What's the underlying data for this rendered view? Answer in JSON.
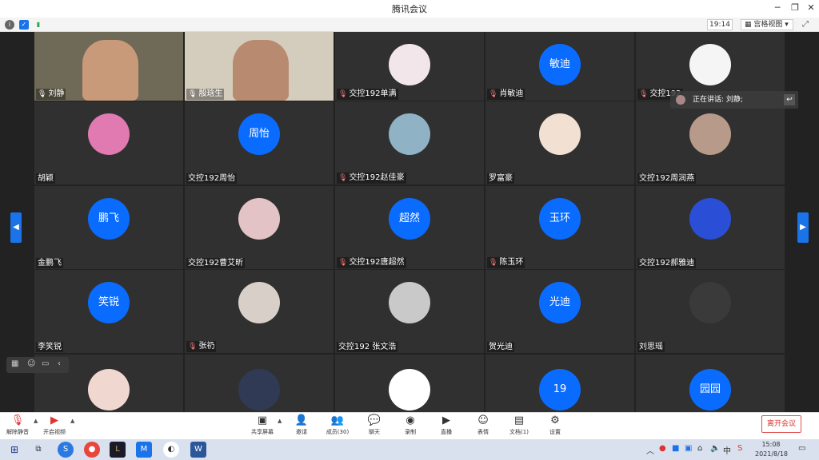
{
  "window": {
    "title": "腾讯会议"
  },
  "infobar": {
    "clock": "19:14",
    "view_mode": "宫格视图"
  },
  "speaking": {
    "label": "正在讲话: 刘静;"
  },
  "tiles": [
    {
      "name": "刘静",
      "type": "video",
      "mic": "on",
      "tone": "video1"
    },
    {
      "name": "殷琀生",
      "type": "video",
      "mic": "on",
      "tone": "video2"
    },
    {
      "name": "交控192单满",
      "type": "image",
      "mic": "muted",
      "avatar_color": "#f2e6ea"
    },
    {
      "name": "肖敏迪",
      "type": "text",
      "mic": "muted",
      "avatar_text": "敏迪"
    },
    {
      "name": "交控192",
      "type": "image",
      "mic": "muted",
      "avatar_color": "#f5f5f5"
    },
    {
      "name": "胡颖",
      "type": "image",
      "mic": "none",
      "avatar_color": "#e07ab0"
    },
    {
      "name": "交控192周怡",
      "type": "text",
      "mic": "none",
      "avatar_text": "周怡"
    },
    {
      "name": "交控192赵佳豪",
      "type": "image",
      "mic": "muted",
      "avatar_color": "#8fb3c4"
    },
    {
      "name": "罗富豪",
      "type": "image",
      "mic": "none",
      "avatar_color": "#f2e1d2"
    },
    {
      "name": "交控192周润燕",
      "type": "image",
      "mic": "none",
      "avatar_color": "#b79a8a"
    },
    {
      "name": "金鹏飞",
      "type": "text",
      "mic": "none",
      "avatar_text": "鹏飞"
    },
    {
      "name": "交控192曹艾昕",
      "type": "image",
      "mic": "none",
      "avatar_color": "#e3c3c6"
    },
    {
      "name": "交控192唐超然",
      "type": "text",
      "mic": "muted",
      "avatar_text": "超然"
    },
    {
      "name": "陈玉环",
      "type": "text",
      "mic": "muted",
      "avatar_text": "玉环"
    },
    {
      "name": "交控192郝雅迪",
      "type": "image",
      "mic": "none",
      "avatar_color": "#2a4fd6"
    },
    {
      "name": "李笑锐",
      "type": "text",
      "mic": "none",
      "avatar_text": "笑锐"
    },
    {
      "name": "张礽",
      "type": "image",
      "mic": "muted",
      "avatar_color": "#d8d0c8"
    },
    {
      "name": "交控192 张文浩",
      "type": "image",
      "mic": "none",
      "avatar_color": "#c9c9c9"
    },
    {
      "name": "贺光迪",
      "type": "text",
      "mic": "none",
      "avatar_text": "光迪"
    },
    {
      "name": "刘思瑶",
      "type": "image",
      "mic": "none",
      "avatar_color": "#3a3a3a"
    },
    {
      "name": "",
      "type": "image",
      "mic": "none",
      "avatar_color": "#f0d8d0"
    },
    {
      "name": "",
      "type": "image",
      "mic": "none",
      "avatar_color": "#303a55"
    },
    {
      "name": "",
      "type": "image",
      "mic": "none",
      "avatar_color": "#ffffff"
    },
    {
      "name": "",
      "type": "text",
      "mic": "none",
      "avatar_text": "19"
    },
    {
      "name": "",
      "type": "text",
      "mic": "none",
      "avatar_text": "园园"
    }
  ],
  "toolbar": {
    "unmute": "解除静音",
    "start_video": "开启视频",
    "share_screen": "共享屏幕",
    "invite": "邀请",
    "members": "成员(30)",
    "chat": "聊天",
    "record": "录制",
    "live": "直播",
    "reactions": "表情",
    "docs": "文档(1)",
    "settings": "设置",
    "leave": "离开会议"
  },
  "taskbar": {
    "time": "15:08",
    "date": "2021/8/18",
    "ime": "中"
  }
}
